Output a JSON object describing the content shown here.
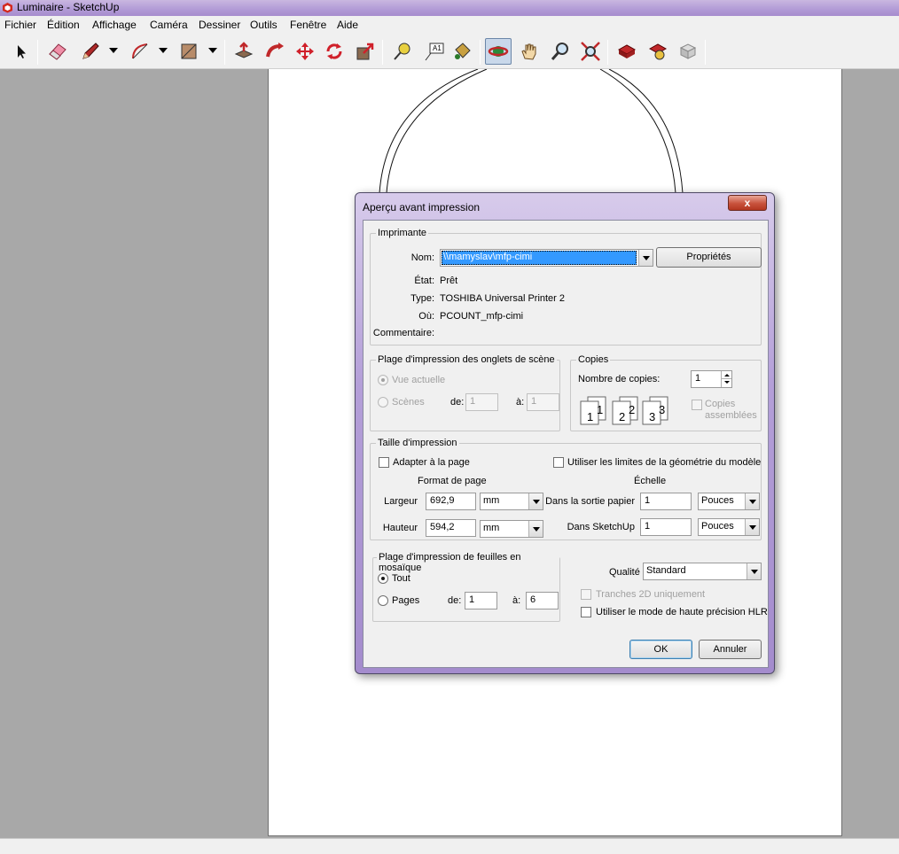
{
  "window": {
    "title": "Luminaire - SketchUp"
  },
  "menu": [
    "Fichier",
    "Édition",
    "Affichage",
    "Caméra",
    "Dessiner",
    "Outils",
    "Fenêtre",
    "Aide"
  ],
  "toolbar": {
    "tools": [
      "select-icon",
      "eraser-icon",
      "pencil-icon",
      "arc-icon",
      "rectangle-icon",
      "push-pull-icon",
      "follow-me-icon",
      "move-icon",
      "rotate-icon",
      "scale-icon",
      "tape-measure-icon",
      "text-icon",
      "paint-bucket-icon",
      "orbit-icon",
      "pan-icon",
      "zoom-icon",
      "zoom-extents-icon",
      "get-models-icon",
      "share-model-icon",
      "components-icon"
    ],
    "text_tool_label": "A1",
    "active_tool": "orbit-icon"
  },
  "dialog": {
    "title": "Aperçu avant impression",
    "close_label": "x",
    "printer": {
      "group_title": "Imprimante",
      "name_label": "Nom:",
      "name_value": "\\\\mamyslav\\mfp-cimi",
      "properties_button": "Propriétés",
      "status_label": "État:",
      "status_value": "Prêt",
      "type_label": "Type:",
      "type_value": "TOSHIBA Universal Printer 2",
      "where_label": "Où:",
      "where_value": "PCOUNT_mfp-cimi",
      "comment_label": "Commentaire:",
      "comment_value": ""
    },
    "scene_range": {
      "group_title": "Plage d'impression des onglets de scène",
      "current_view": "Vue actuelle",
      "scenes": "Scènes",
      "from_label": "de:",
      "from_value": "1",
      "to_label": "à:",
      "to_value": "1"
    },
    "copies": {
      "group_title": "Copies",
      "count_label": "Nombre de copies:",
      "count_value": "1",
      "collate_label_1": "Copies",
      "collate_label_2": "assemblées",
      "stack_numbers": [
        "1",
        "1",
        "2",
        "2",
        "3",
        "3"
      ]
    },
    "print_size": {
      "group_title": "Taille d'impression",
      "fit_page": "Adapter à la page",
      "use_model_extents": "Utiliser les limites de la géométrie du modèle",
      "page_format_title": "Format de page",
      "scale_title": "Échelle",
      "width_label": "Largeur",
      "width_value": "692,9",
      "width_unit": "mm",
      "height_label": "Hauteur",
      "height_value": "594,2",
      "height_unit": "mm",
      "paper_output_label": "Dans la sortie papier",
      "paper_output_value": "1",
      "paper_output_unit": "Pouces",
      "in_sketchup_label": "Dans SketchUp",
      "in_sketchup_value": "1",
      "in_sketchup_unit": "Pouces"
    },
    "tiled_range": {
      "group_title": "Plage d'impression de feuilles en mosaïque",
      "all": "Tout",
      "pages": "Pages",
      "from_label": "de:",
      "from_value": "1",
      "to_label": "à:",
      "to_value": "6"
    },
    "quality": {
      "label": "Qualité",
      "value": "Standard",
      "slices_2d": "Tranches 2D uniquement",
      "hlr_mode": "Utiliser le mode de haute précision HLR"
    },
    "ok_button": "OK",
    "cancel_button": "Annuler"
  },
  "colors": {
    "title_bar": "#b19ad6",
    "selection": "#3399ff",
    "workspace": "#a8a8a8"
  }
}
